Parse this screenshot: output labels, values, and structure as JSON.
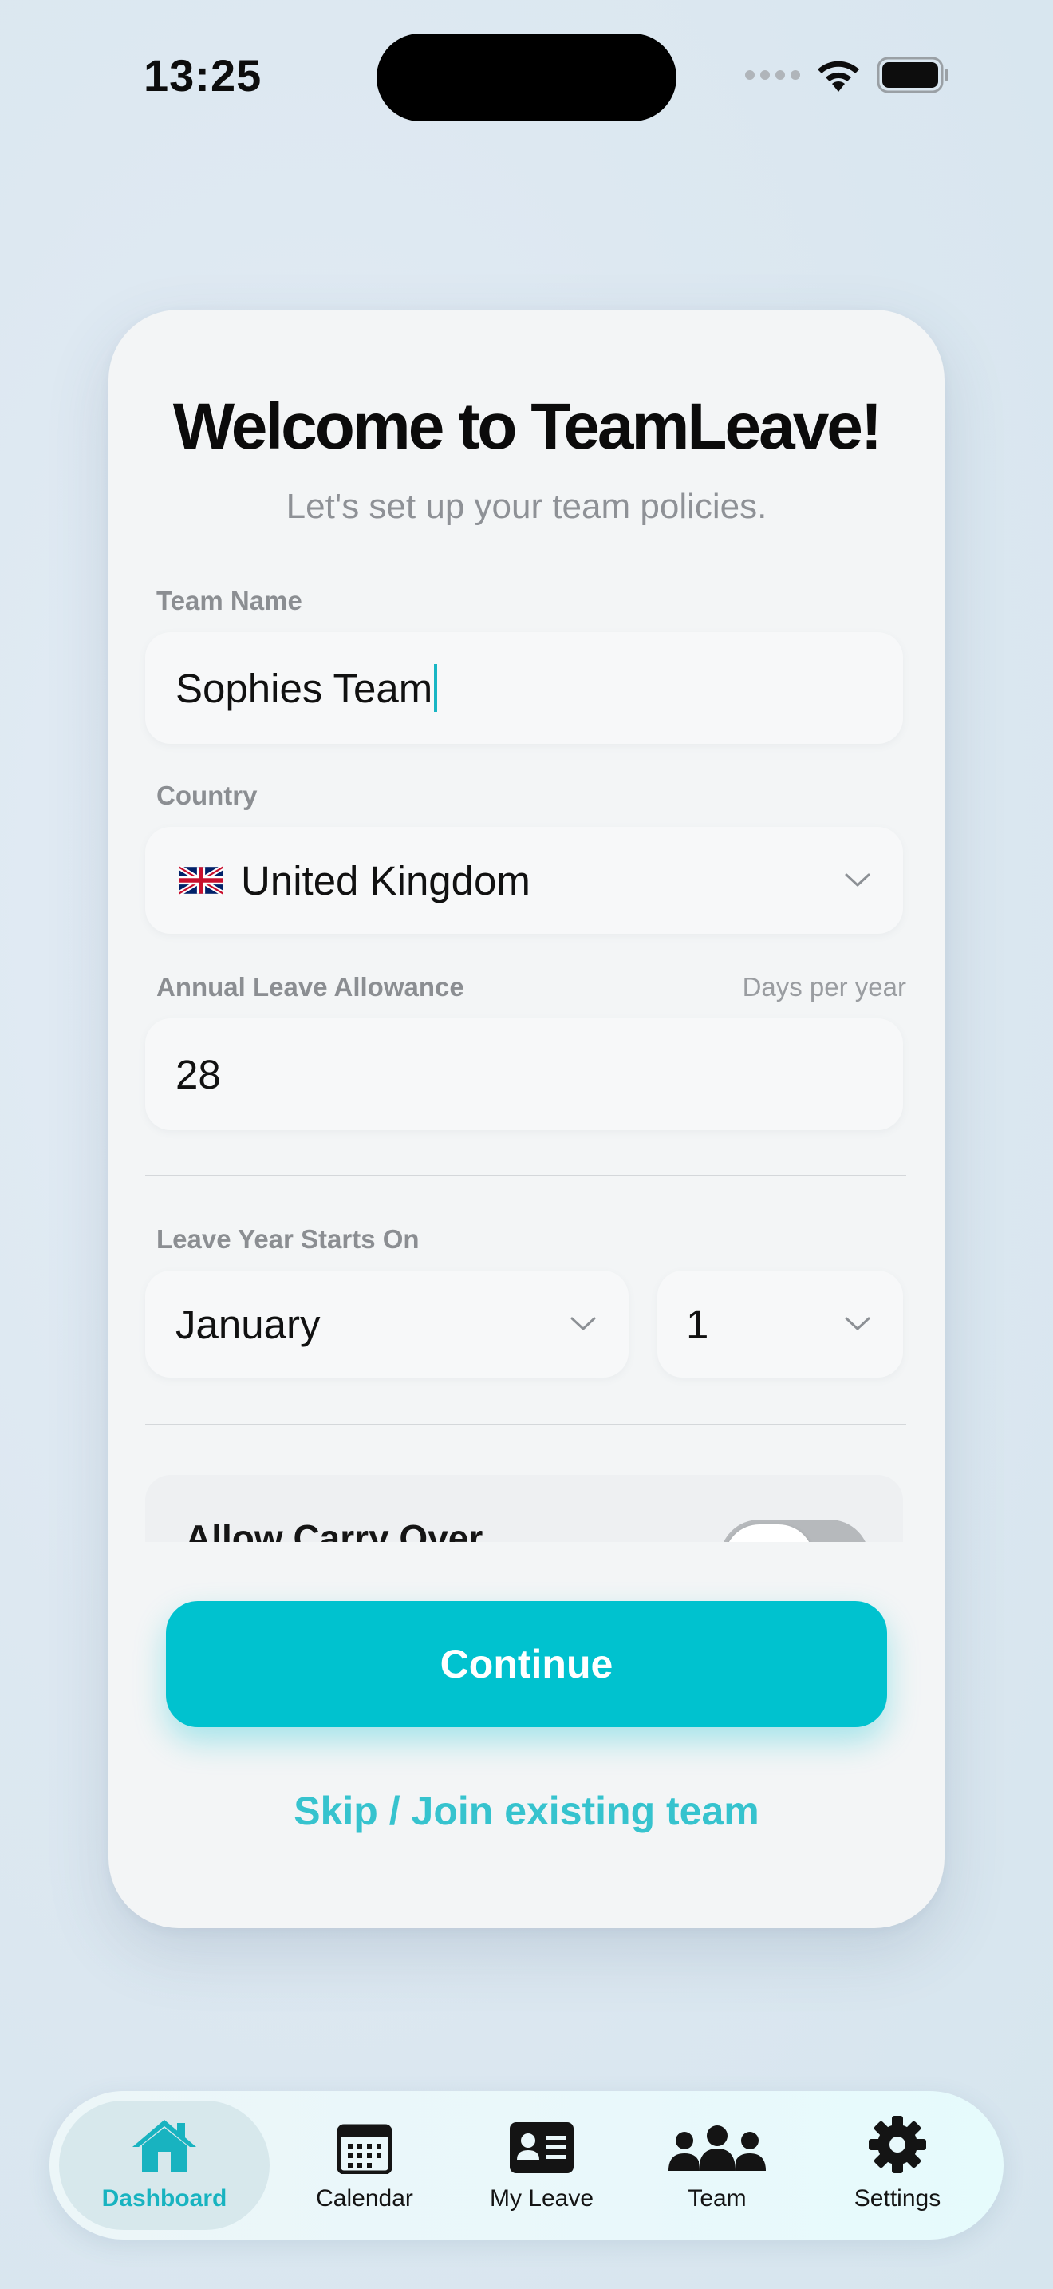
{
  "status_bar": {
    "time": "13:25"
  },
  "onboarding": {
    "title": "Welcome to TeamLeave!",
    "subtitle": "Let's set up your team policies.",
    "team_name": {
      "label": "Team Name",
      "value": "Sophies Team"
    },
    "country": {
      "label": "Country",
      "value": "United Kingdom",
      "flag": "uk-flag-icon"
    },
    "annual_leave": {
      "label": "Annual Leave Allowance",
      "hint": "Days per year",
      "value": "28"
    },
    "leave_year": {
      "label": "Leave Year Starts On",
      "month": "January",
      "day": "1"
    },
    "carry_over": {
      "label": "Allow Carry Over",
      "enabled": false
    },
    "continue_label": "Continue",
    "skip_label": "Skip / Join existing team"
  },
  "colors": {
    "accent": "#00c2cf",
    "link": "#36c3ce",
    "active_tab": "#18b3c0"
  },
  "tabbar": {
    "active": "Dashboard",
    "items": [
      {
        "label": "Dashboard",
        "icon": "home-icon"
      },
      {
        "label": "Calendar",
        "icon": "calendar-icon"
      },
      {
        "label": "My Leave",
        "icon": "id-card-icon"
      },
      {
        "label": "Team",
        "icon": "team-icon"
      },
      {
        "label": "Settings",
        "icon": "gear-icon"
      }
    ]
  }
}
